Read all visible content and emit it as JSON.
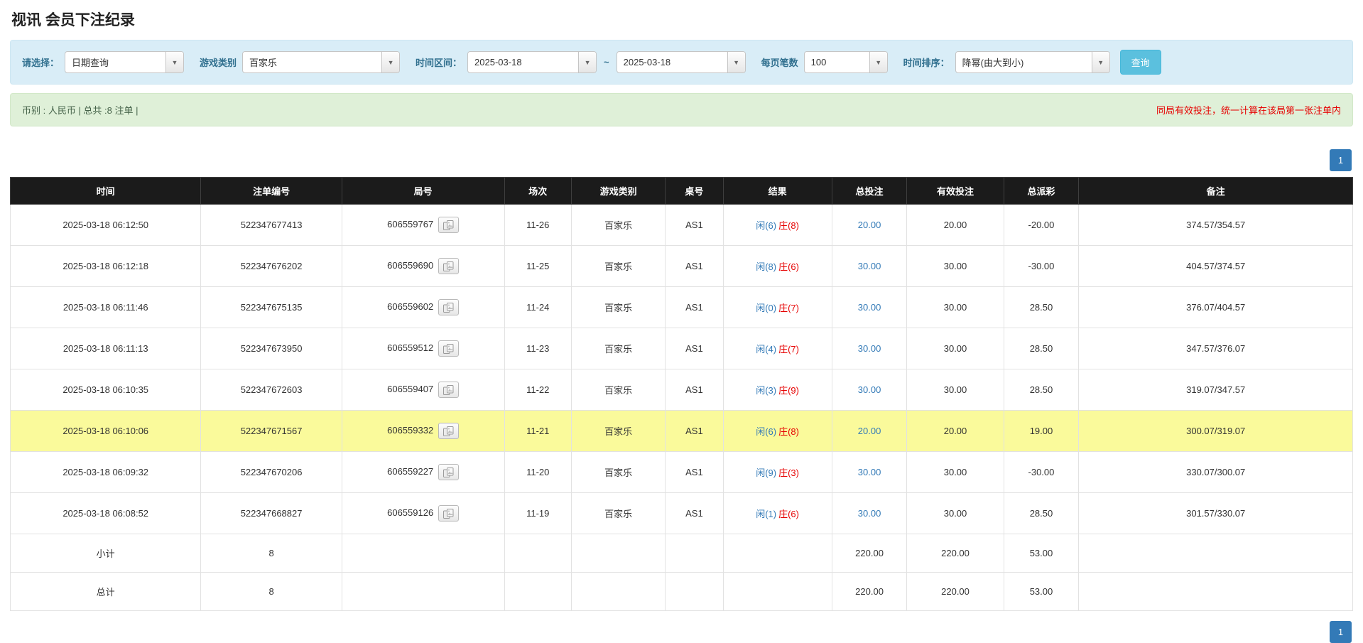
{
  "colors": {
    "accent_blue": "#337ab7",
    "negative_red": "#e60000",
    "filter_bar_bg": "#d9edf7",
    "summary_bar_bg": "#dff0d8",
    "table_header_bg": "#1b1b1b",
    "highlight_row_bg": "#fafa9b",
    "footer_row_bg": "#9d9d9d",
    "search_button_bg": "#5bc0de"
  },
  "page": {
    "title": "视讯 会员下注纪录"
  },
  "filters": {
    "select_label": "请选择：",
    "select_value": "日期查询",
    "game_type_label": "游戏类别",
    "game_type_value": "百家乐",
    "time_range_label": "时间区间：",
    "date_from": "2025-03-18",
    "range_separator": "~",
    "date_to": "2025-03-18",
    "page_size_label": "每页笔数",
    "page_size_value": "100",
    "sort_label": "时间排序：",
    "sort_value": "降幂(由大到小)",
    "search_button": "查询"
  },
  "summary": {
    "left": "币别 : 人民币 | 总共 :8 注单 |",
    "right": "同局有效投注，统一计算在该局第一张注单内"
  },
  "pagination": {
    "current_page": "1"
  },
  "table": {
    "headers": [
      "时间",
      "注单编号",
      "局号",
      "场次",
      "游戏类别",
      "桌号",
      "结果",
      "总投注",
      "有效投注",
      "总派彩",
      "备注"
    ],
    "rows": [
      {
        "time": "2025-03-18 06:12:50",
        "bet_id": "522347677413",
        "round_id": "606559767",
        "session": "11-26",
        "game_type": "百家乐",
        "table_no": "AS1",
        "result_player": "闲(6)",
        "result_banker": "庄(8)",
        "total_bet": "20.00",
        "valid_bet": "20.00",
        "payout": "-20.00",
        "note": "374.57/354.57",
        "highlight": false
      },
      {
        "time": "2025-03-18 06:12:18",
        "bet_id": "522347676202",
        "round_id": "606559690",
        "session": "11-25",
        "game_type": "百家乐",
        "table_no": "AS1",
        "result_player": "闲(8)",
        "result_banker": "庄(6)",
        "total_bet": "30.00",
        "valid_bet": "30.00",
        "payout": "-30.00",
        "note": "404.57/374.57",
        "highlight": false
      },
      {
        "time": "2025-03-18 06:11:46",
        "bet_id": "522347675135",
        "round_id": "606559602",
        "session": "11-24",
        "game_type": "百家乐",
        "table_no": "AS1",
        "result_player": "闲(0)",
        "result_banker": "庄(7)",
        "total_bet": "30.00",
        "valid_bet": "30.00",
        "payout": "28.50",
        "note": "376.07/404.57",
        "highlight": false
      },
      {
        "time": "2025-03-18 06:11:13",
        "bet_id": "522347673950",
        "round_id": "606559512",
        "session": "11-23",
        "game_type": "百家乐",
        "table_no": "AS1",
        "result_player": "闲(4)",
        "result_banker": "庄(7)",
        "total_bet": "30.00",
        "valid_bet": "30.00",
        "payout": "28.50",
        "note": "347.57/376.07",
        "highlight": false
      },
      {
        "time": "2025-03-18 06:10:35",
        "bet_id": "522347672603",
        "round_id": "606559407",
        "session": "11-22",
        "game_type": "百家乐",
        "table_no": "AS1",
        "result_player": "闲(3)",
        "result_banker": "庄(9)",
        "total_bet": "30.00",
        "valid_bet": "30.00",
        "payout": "28.50",
        "note": "319.07/347.57",
        "highlight": false
      },
      {
        "time": "2025-03-18 06:10:06",
        "bet_id": "522347671567",
        "round_id": "606559332",
        "session": "11-21",
        "game_type": "百家乐",
        "table_no": "AS1",
        "result_player": "闲(6)",
        "result_banker": "庄(8)",
        "total_bet": "20.00",
        "valid_bet": "20.00",
        "payout": "19.00",
        "note": "300.07/319.07",
        "highlight": true
      },
      {
        "time": "2025-03-18 06:09:32",
        "bet_id": "522347670206",
        "round_id": "606559227",
        "session": "11-20",
        "game_type": "百家乐",
        "table_no": "AS1",
        "result_player": "闲(9)",
        "result_banker": "庄(3)",
        "total_bet": "30.00",
        "valid_bet": "30.00",
        "payout": "-30.00",
        "note": "330.07/300.07",
        "highlight": false
      },
      {
        "time": "2025-03-18 06:08:52",
        "bet_id": "522347668827",
        "round_id": "606559126",
        "session": "11-19",
        "game_type": "百家乐",
        "table_no": "AS1",
        "result_player": "闲(1)",
        "result_banker": "庄(6)",
        "total_bet": "30.00",
        "valid_bet": "30.00",
        "payout": "28.50",
        "note": "301.57/330.07",
        "highlight": false
      }
    ],
    "subtotal": {
      "label": "小计",
      "count": "8",
      "total_bet": "220.00",
      "valid_bet": "220.00",
      "payout": "53.00"
    },
    "total": {
      "label": "总计",
      "count": "8",
      "total_bet": "220.00",
      "valid_bet": "220.00",
      "payout": "53.00"
    }
  }
}
